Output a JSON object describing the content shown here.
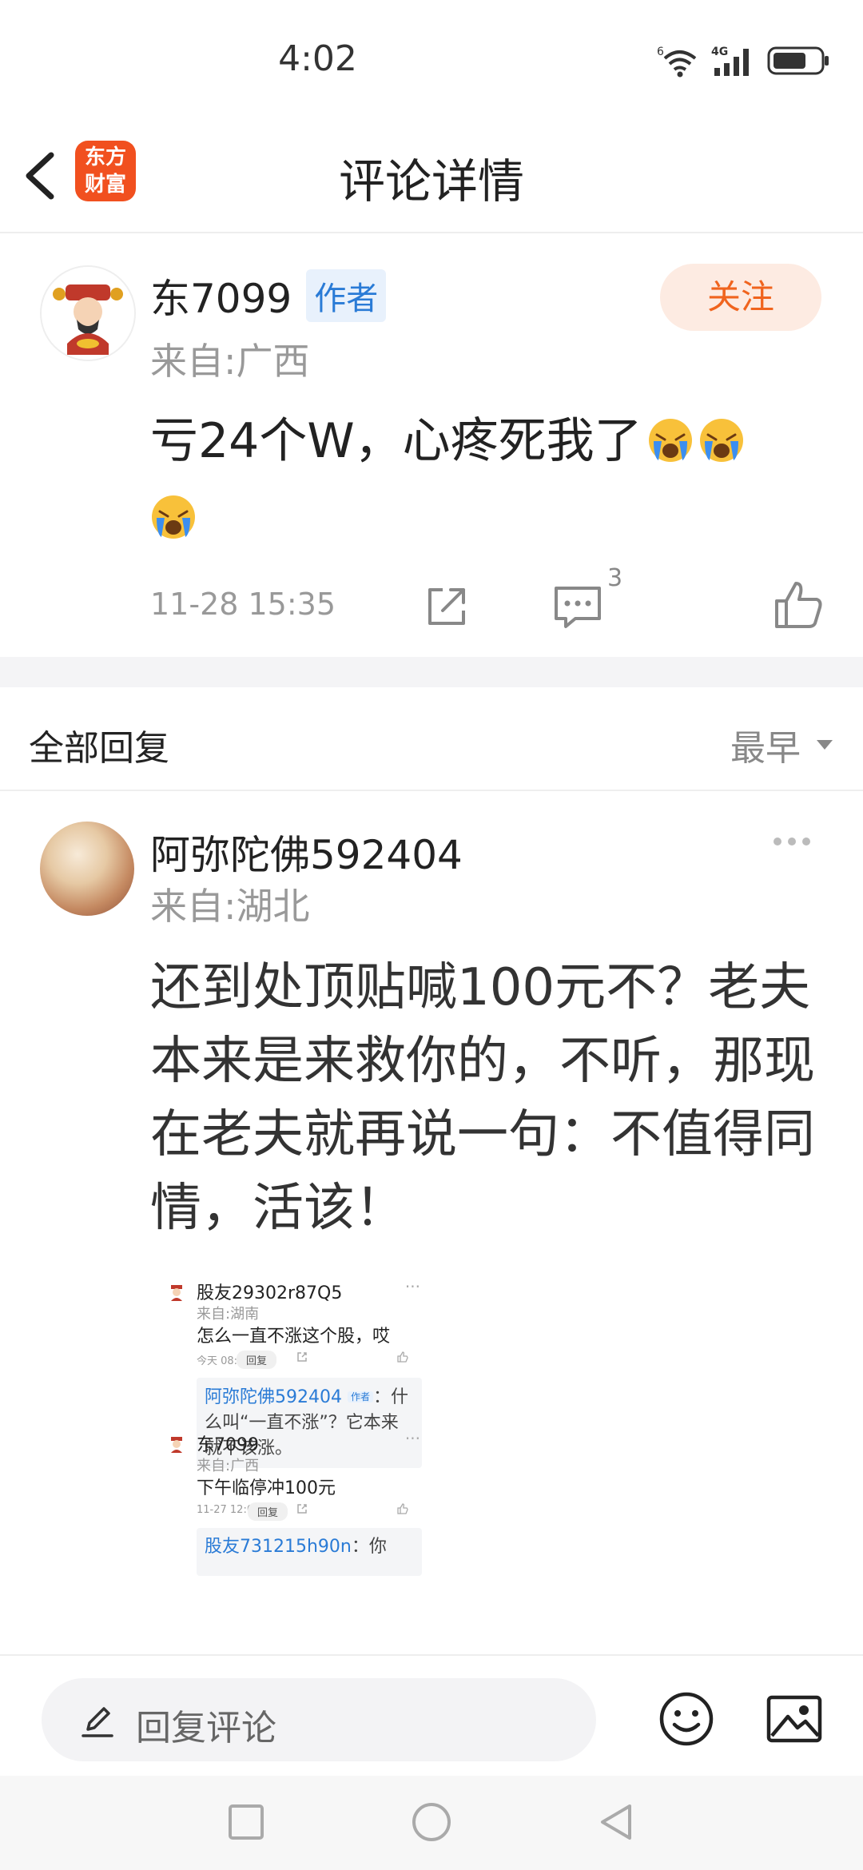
{
  "status_bar": {
    "time": "4:02",
    "network": "4G",
    "wifi_label": "6"
  },
  "nav": {
    "title": "评论详情",
    "logo_text_line1": "东方",
    "logo_text_line2": "财富"
  },
  "post": {
    "username": "东7099",
    "author_tag": "作者",
    "location": "来自:广西",
    "follow_label": "关注",
    "text": "亏24个W，心疼死我了",
    "emojis": [
      "crying-face",
      "crying-face",
      "crying-face"
    ],
    "time": "11-28 15:35",
    "comment_count": "3"
  },
  "replies": {
    "title": "全部回复",
    "sort_label": "最早"
  },
  "reply": {
    "username": "阿弥陀佛592404",
    "location": "来自:湖北",
    "text": "还到处顶贴喊100元不？老夫本来是来救你的，不听，那现在老夫就再说一句：不值得同情，活该！",
    "screenshot": {
      "items": [
        {
          "name": "股友29302r87Q5",
          "location": "来自:湖南",
          "text": "怎么一直不涨这个股，哎",
          "time": "今天 08:35",
          "reply_label": "回复",
          "quote_user": "阿弥陀佛592404",
          "quote_tag": "作者",
          "quote_text": "：什么叫“一直不涨”？它本来就不该涨。"
        },
        {
          "name": "东7099",
          "location": "来自:广西",
          "text": "下午临停冲100元",
          "time": "11-27 12:00",
          "reply_label": "回复",
          "quote_user": "股友731215h90n",
          "quote_text": "：你"
        }
      ]
    }
  },
  "bottom": {
    "placeholder": "回复评论"
  }
}
